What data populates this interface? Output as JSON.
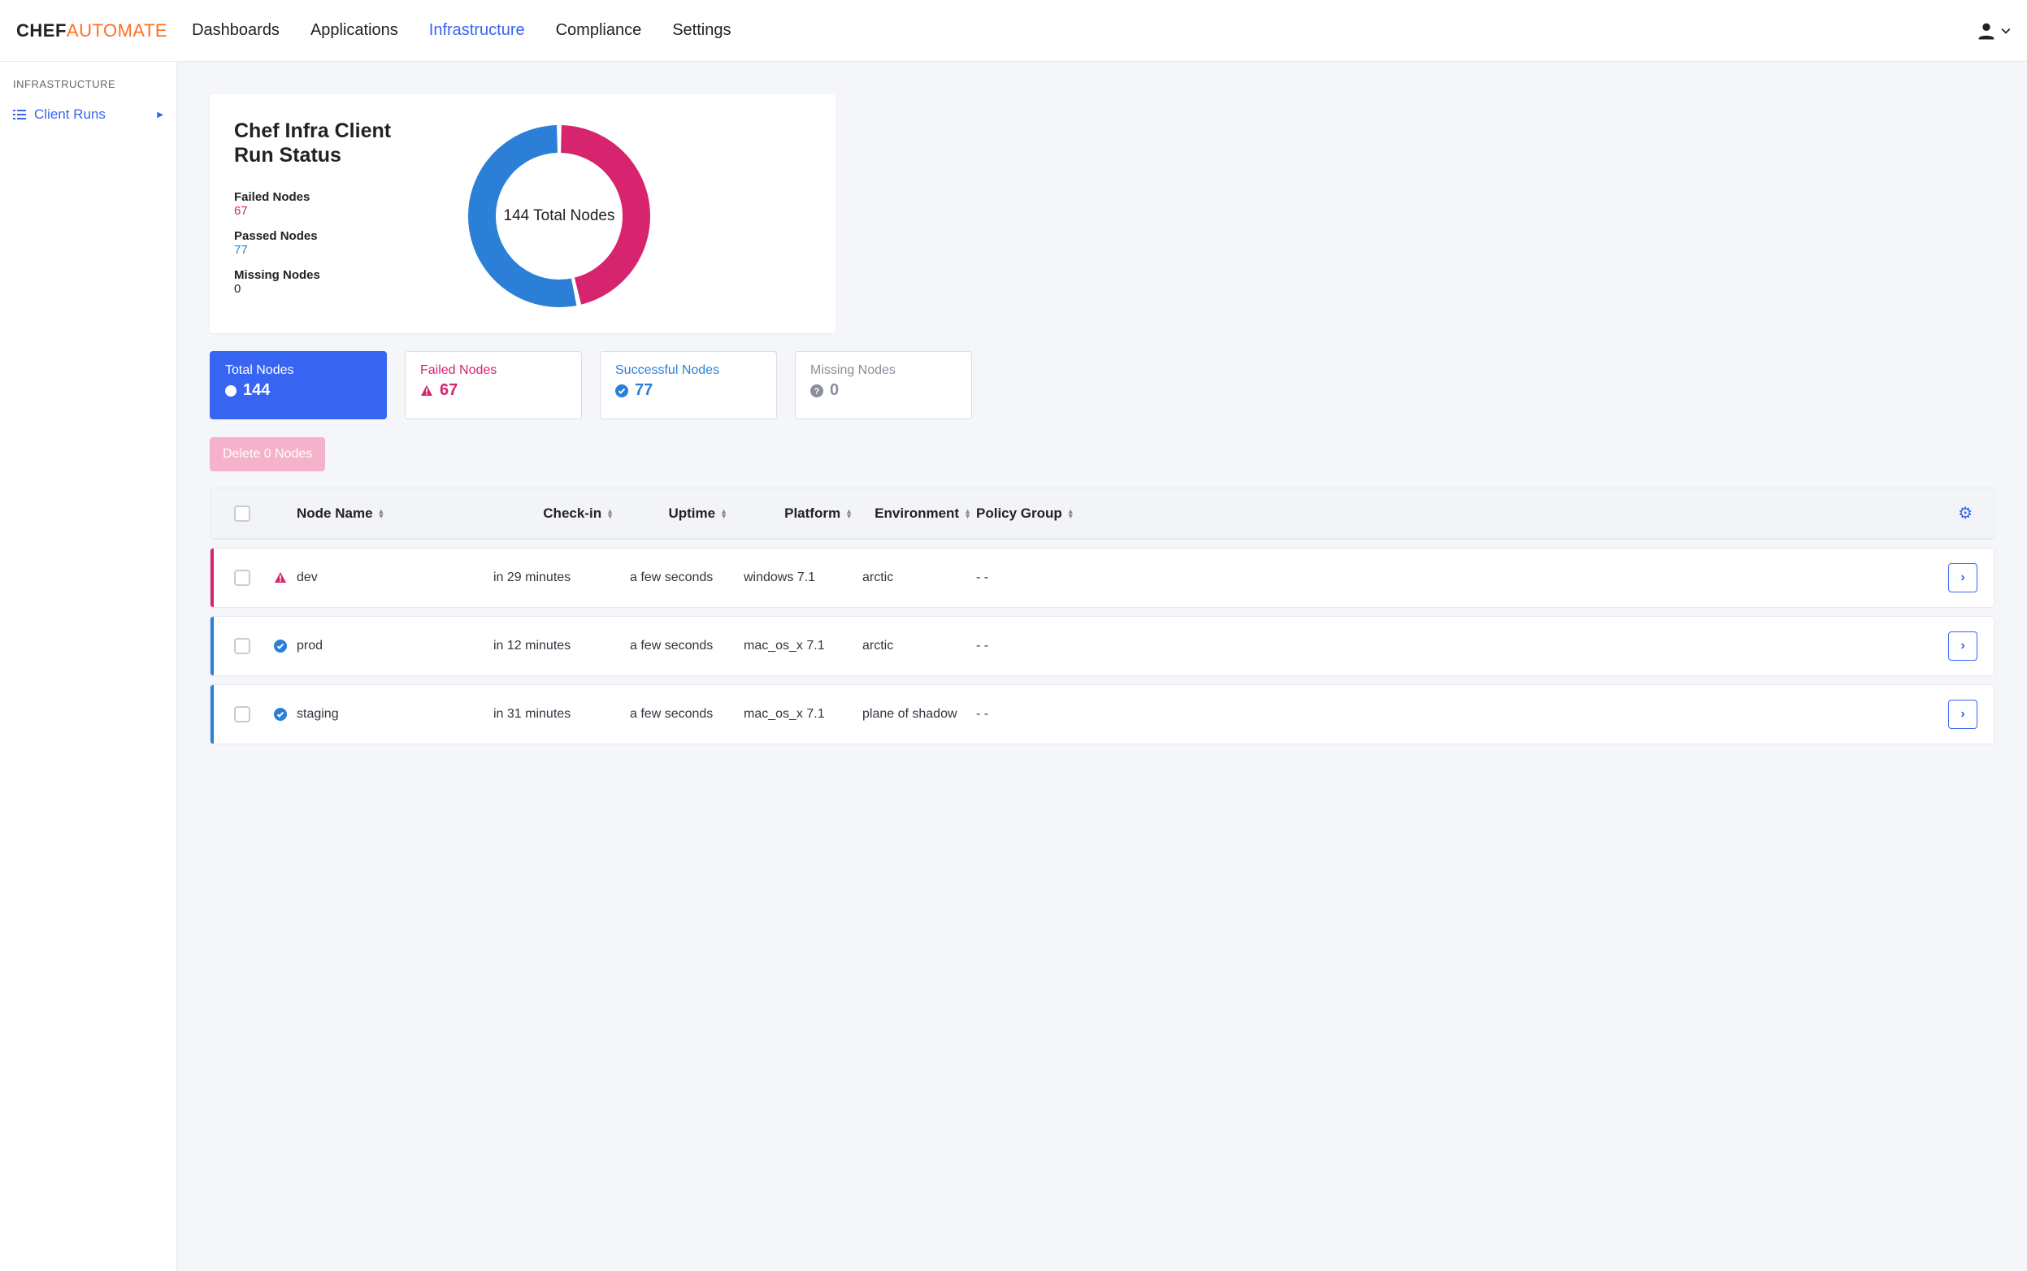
{
  "brand": {
    "chef": "CHEF",
    "automate": "AUTOMATE"
  },
  "nav": {
    "items": [
      {
        "label": "Dashboards",
        "active": false
      },
      {
        "label": "Applications",
        "active": false
      },
      {
        "label": "Infrastructure",
        "active": true
      },
      {
        "label": "Compliance",
        "active": false
      },
      {
        "label": "Settings",
        "active": false
      }
    ]
  },
  "sidebar": {
    "heading": "INFRASTRUCTURE",
    "items": [
      {
        "label": "Client Runs"
      }
    ]
  },
  "status": {
    "title": "Chef Infra Client Run Status",
    "stats": {
      "failed_label": "Failed Nodes",
      "failed_count": "67",
      "passed_label": "Passed Nodes",
      "passed_count": "77",
      "missing_label": "Missing Nodes",
      "missing_count": "0"
    },
    "chart_center": "144 Total Nodes"
  },
  "chart_data": {
    "type": "pie",
    "title": "Chef Infra Client Run Status",
    "series": [
      {
        "name": "Failed Nodes",
        "value": 67,
        "color": "#d6246e"
      },
      {
        "name": "Passed Nodes",
        "value": 77,
        "color": "#2b7fd6"
      },
      {
        "name": "Missing Nodes",
        "value": 0,
        "color": "#8a8f99"
      }
    ],
    "total_label": "144 Total Nodes",
    "total": 144
  },
  "tiles": [
    {
      "label": "Total Nodes",
      "count": "144",
      "kind": "total",
      "active": true
    },
    {
      "label": "Failed Nodes",
      "count": "67",
      "kind": "failed",
      "active": false
    },
    {
      "label": "Successful Nodes",
      "count": "77",
      "kind": "success",
      "active": false
    },
    {
      "label": "Missing Nodes",
      "count": "0",
      "kind": "missing",
      "active": false
    }
  ],
  "delete_button": "Delete 0 Nodes",
  "table": {
    "headers": {
      "node_name": "Node Name",
      "check_in": "Check-in",
      "uptime": "Uptime",
      "platform": "Platform",
      "environment": "Environment",
      "policy_group": "Policy Group"
    },
    "rows": [
      {
        "status": "failed",
        "name": "dev",
        "check_in": "in 29 minutes",
        "uptime": "a few seconds",
        "platform": "windows 7.1",
        "environment": "arctic",
        "policy_group": "- -"
      },
      {
        "status": "success",
        "name": "prod",
        "check_in": "in 12 minutes",
        "uptime": "a few seconds",
        "platform": "mac_os_x 7.1",
        "environment": "arctic",
        "policy_group": "- -"
      },
      {
        "status": "success",
        "name": "staging",
        "check_in": "in 31 minutes",
        "uptime": "a few seconds",
        "platform": "mac_os_x 7.1",
        "environment": "plane of shadow",
        "policy_group": "- -"
      }
    ]
  }
}
